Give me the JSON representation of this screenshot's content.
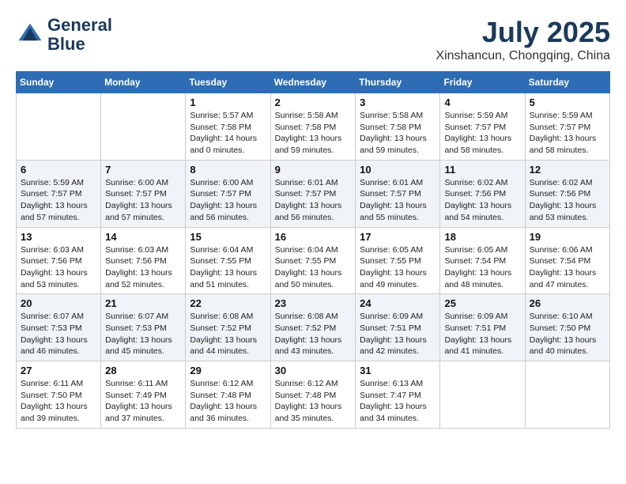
{
  "header": {
    "logo_line1": "General",
    "logo_line2": "Blue",
    "month": "July 2025",
    "location": "Xinshancun, Chongqing, China"
  },
  "weekdays": [
    "Sunday",
    "Monday",
    "Tuesday",
    "Wednesday",
    "Thursday",
    "Friday",
    "Saturday"
  ],
  "weeks": [
    [
      {
        "day": "",
        "info": ""
      },
      {
        "day": "",
        "info": ""
      },
      {
        "day": "1",
        "info": "Sunrise: 5:57 AM\nSunset: 7:58 PM\nDaylight: 14 hours\nand 0 minutes."
      },
      {
        "day": "2",
        "info": "Sunrise: 5:58 AM\nSunset: 7:58 PM\nDaylight: 13 hours\nand 59 minutes."
      },
      {
        "day": "3",
        "info": "Sunrise: 5:58 AM\nSunset: 7:58 PM\nDaylight: 13 hours\nand 59 minutes."
      },
      {
        "day": "4",
        "info": "Sunrise: 5:59 AM\nSunset: 7:57 PM\nDaylight: 13 hours\nand 58 minutes."
      },
      {
        "day": "5",
        "info": "Sunrise: 5:59 AM\nSunset: 7:57 PM\nDaylight: 13 hours\nand 58 minutes."
      }
    ],
    [
      {
        "day": "6",
        "info": "Sunrise: 5:59 AM\nSunset: 7:57 PM\nDaylight: 13 hours\nand 57 minutes."
      },
      {
        "day": "7",
        "info": "Sunrise: 6:00 AM\nSunset: 7:57 PM\nDaylight: 13 hours\nand 57 minutes."
      },
      {
        "day": "8",
        "info": "Sunrise: 6:00 AM\nSunset: 7:57 PM\nDaylight: 13 hours\nand 56 minutes."
      },
      {
        "day": "9",
        "info": "Sunrise: 6:01 AM\nSunset: 7:57 PM\nDaylight: 13 hours\nand 56 minutes."
      },
      {
        "day": "10",
        "info": "Sunrise: 6:01 AM\nSunset: 7:57 PM\nDaylight: 13 hours\nand 55 minutes."
      },
      {
        "day": "11",
        "info": "Sunrise: 6:02 AM\nSunset: 7:56 PM\nDaylight: 13 hours\nand 54 minutes."
      },
      {
        "day": "12",
        "info": "Sunrise: 6:02 AM\nSunset: 7:56 PM\nDaylight: 13 hours\nand 53 minutes."
      }
    ],
    [
      {
        "day": "13",
        "info": "Sunrise: 6:03 AM\nSunset: 7:56 PM\nDaylight: 13 hours\nand 53 minutes."
      },
      {
        "day": "14",
        "info": "Sunrise: 6:03 AM\nSunset: 7:56 PM\nDaylight: 13 hours\nand 52 minutes."
      },
      {
        "day": "15",
        "info": "Sunrise: 6:04 AM\nSunset: 7:55 PM\nDaylight: 13 hours\nand 51 minutes."
      },
      {
        "day": "16",
        "info": "Sunrise: 6:04 AM\nSunset: 7:55 PM\nDaylight: 13 hours\nand 50 minutes."
      },
      {
        "day": "17",
        "info": "Sunrise: 6:05 AM\nSunset: 7:55 PM\nDaylight: 13 hours\nand 49 minutes."
      },
      {
        "day": "18",
        "info": "Sunrise: 6:05 AM\nSunset: 7:54 PM\nDaylight: 13 hours\nand 48 minutes."
      },
      {
        "day": "19",
        "info": "Sunrise: 6:06 AM\nSunset: 7:54 PM\nDaylight: 13 hours\nand 47 minutes."
      }
    ],
    [
      {
        "day": "20",
        "info": "Sunrise: 6:07 AM\nSunset: 7:53 PM\nDaylight: 13 hours\nand 46 minutes."
      },
      {
        "day": "21",
        "info": "Sunrise: 6:07 AM\nSunset: 7:53 PM\nDaylight: 13 hours\nand 45 minutes."
      },
      {
        "day": "22",
        "info": "Sunrise: 6:08 AM\nSunset: 7:52 PM\nDaylight: 13 hours\nand 44 minutes."
      },
      {
        "day": "23",
        "info": "Sunrise: 6:08 AM\nSunset: 7:52 PM\nDaylight: 13 hours\nand 43 minutes."
      },
      {
        "day": "24",
        "info": "Sunrise: 6:09 AM\nSunset: 7:51 PM\nDaylight: 13 hours\nand 42 minutes."
      },
      {
        "day": "25",
        "info": "Sunrise: 6:09 AM\nSunset: 7:51 PM\nDaylight: 13 hours\nand 41 minutes."
      },
      {
        "day": "26",
        "info": "Sunrise: 6:10 AM\nSunset: 7:50 PM\nDaylight: 13 hours\nand 40 minutes."
      }
    ],
    [
      {
        "day": "27",
        "info": "Sunrise: 6:11 AM\nSunset: 7:50 PM\nDaylight: 13 hours\nand 39 minutes."
      },
      {
        "day": "28",
        "info": "Sunrise: 6:11 AM\nSunset: 7:49 PM\nDaylight: 13 hours\nand 37 minutes."
      },
      {
        "day": "29",
        "info": "Sunrise: 6:12 AM\nSunset: 7:48 PM\nDaylight: 13 hours\nand 36 minutes."
      },
      {
        "day": "30",
        "info": "Sunrise: 6:12 AM\nSunset: 7:48 PM\nDaylight: 13 hours\nand 35 minutes."
      },
      {
        "day": "31",
        "info": "Sunrise: 6:13 AM\nSunset: 7:47 PM\nDaylight: 13 hours\nand 34 minutes."
      },
      {
        "day": "",
        "info": ""
      },
      {
        "day": "",
        "info": ""
      }
    ]
  ]
}
